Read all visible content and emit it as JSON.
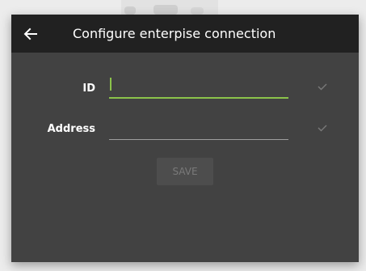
{
  "dialog": {
    "title": "Configure enterpise connection",
    "back_icon": "arrow-left-icon"
  },
  "form": {
    "id_label": "ID",
    "id_value": "",
    "address_label": "Address",
    "address_value": "",
    "check_icon": "checkmark-icon"
  },
  "actions": {
    "save_label": "SAVE",
    "save_enabled": false
  },
  "colors": {
    "dialog_bg": "#424242",
    "header_bg": "#212121",
    "accent": "#8bc34a",
    "text": "#ffffff",
    "disabled_text": "#7a7a7a"
  }
}
